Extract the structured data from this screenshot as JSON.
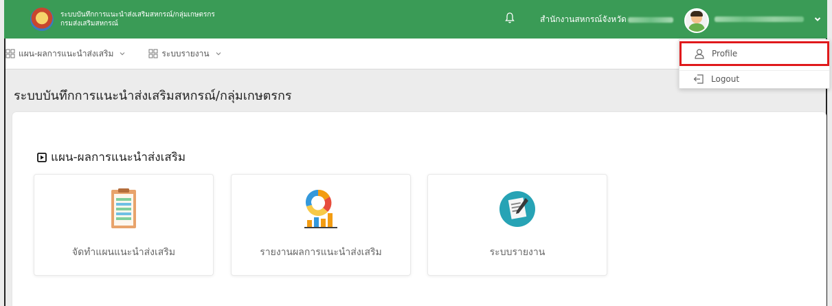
{
  "header": {
    "system_title": "ระบบบันทึกการแนะนำส่งเสริมสหกรณ์/กลุ่มเกษตรกร",
    "department": "กรมส่งเสริมสหกรณ์",
    "org_label": "สำนักงานสหกรณ์จังหวัด",
    "bar_color": "#3a9b56"
  },
  "menu": [
    {
      "label": "แผน-ผลการแนะนำส่งเสริม"
    },
    {
      "label": "ระบบรายงาน"
    }
  ],
  "user_menu": {
    "profile": "Profile",
    "logout": "Logout",
    "highlight_color": "#e0191b"
  },
  "page": {
    "title": "ระบบบันทึกการแนะนำส่งเสริมสหกรณ์/กลุ่มเกษตรกร",
    "section_title": "แผน-ผลการแนะนำส่งเสริม",
    "tiles": [
      {
        "label": "จัดทำแผนแนะนำส่งเสริม",
        "icon": "clipboard-icon"
      },
      {
        "label": "รายงานผลการแนะนำส่งเสริม",
        "icon": "chart-icon"
      },
      {
        "label": "ระบบรายงาน",
        "icon": "report-icon"
      }
    ]
  }
}
